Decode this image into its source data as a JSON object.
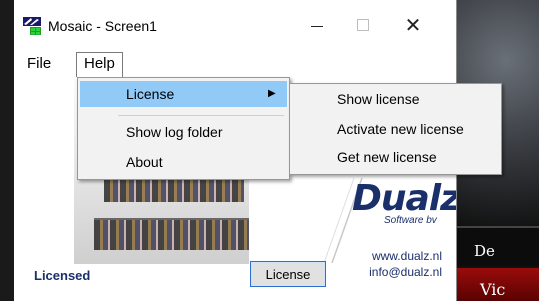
{
  "window": {
    "title": "Mosaic - Screen1",
    "close_glyph": "✕",
    "colors": {
      "accent_blue": "#1b2f6b",
      "menu_highlight": "#91c9f7"
    }
  },
  "menubar": {
    "items": [
      {
        "label": "File"
      },
      {
        "label": "Help"
      }
    ]
  },
  "help_menu": {
    "items": [
      {
        "label": "License",
        "has_submenu": true,
        "highlighted": true
      },
      {
        "label": "Show log folder"
      },
      {
        "label": "About"
      }
    ],
    "arrow_glyph": "▶"
  },
  "license_submenu": {
    "items": [
      {
        "label": "Show license"
      },
      {
        "label": "Activate new license"
      },
      {
        "label": "Get new license"
      }
    ]
  },
  "content": {
    "logo": {
      "word": "Dualz",
      "subtitle": "Software bv"
    },
    "contact": {
      "website": "www.dualz.nl",
      "email": "info@dualz.nl"
    },
    "status": "Licensed",
    "license_button": "License"
  },
  "background": {
    "text_1": "De",
    "text_2": "Vic"
  }
}
